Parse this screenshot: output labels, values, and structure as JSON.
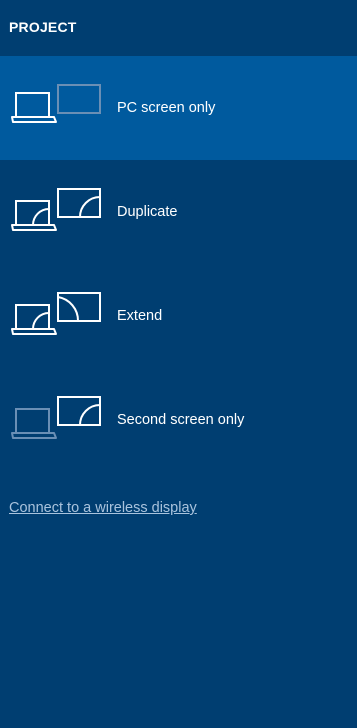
{
  "panel": {
    "title": "PROJECT"
  },
  "options": [
    {
      "label": "PC screen only",
      "icon": "pc-screen-only-icon",
      "selected": true
    },
    {
      "label": "Duplicate",
      "icon": "duplicate-icon",
      "selected": false
    },
    {
      "label": "Extend",
      "icon": "extend-icon",
      "selected": false
    },
    {
      "label": "Second screen only",
      "icon": "second-screen-only-icon",
      "selected": false
    }
  ],
  "link": {
    "label": "Connect to a wireless display"
  },
  "colors": {
    "background": "#003e71",
    "selected": "#005a9e",
    "link": "#a9c3dd",
    "dim_icon": "#6a8fb5"
  }
}
